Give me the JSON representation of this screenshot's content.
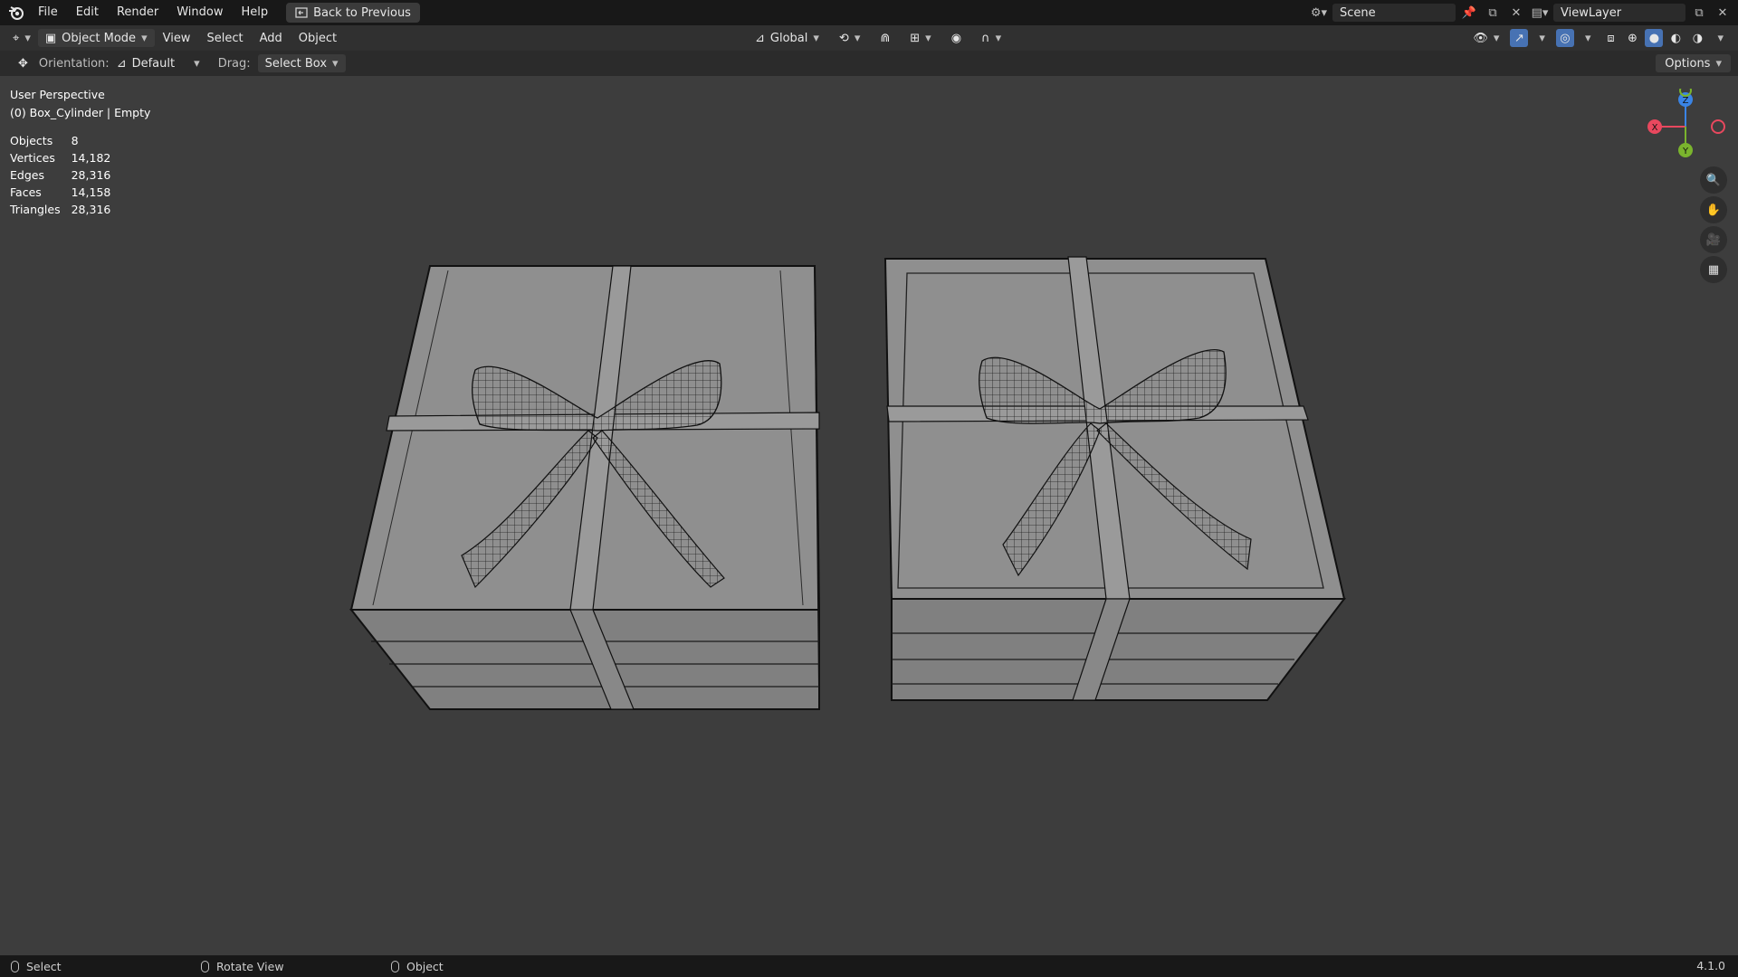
{
  "topbar": {
    "menus": [
      "File",
      "Edit",
      "Render",
      "Window",
      "Help"
    ],
    "back_button": "Back to Previous",
    "scene": "Scene",
    "view_layer": "ViewLayer"
  },
  "header": {
    "mode": "Object Mode",
    "menus": [
      "View",
      "Select",
      "Add",
      "Object"
    ],
    "transform_orientation": "Global"
  },
  "tool_settings": {
    "orientation_label": "Orientation:",
    "orientation_value": "Default",
    "drag_label": "Drag:",
    "drag_value": "Select Box",
    "options_label": "Options"
  },
  "viewport": {
    "view_name": "User Perspective",
    "active_object": "(0) Box_Cylinder | Empty",
    "stats": [
      {
        "label": "Objects",
        "value": "8"
      },
      {
        "label": "Vertices",
        "value": "14,182"
      },
      {
        "label": "Edges",
        "value": "28,316"
      },
      {
        "label": "Faces",
        "value": "14,158"
      },
      {
        "label": "Triangles",
        "value": "28,316"
      }
    ],
    "gizmo": {
      "x": "X",
      "y": "Y",
      "z": "Z"
    }
  },
  "statusbar": {
    "select": "Select",
    "rotate_view": "Rotate View",
    "object": "Object",
    "version": "4.1.0"
  },
  "colors": {
    "viewport_bg": "#3d3d3d",
    "mesh_fill": "#8e8e8e",
    "axis_x": "#e8485e",
    "axis_y": "#7ab42d",
    "axis_z": "#3a84e5",
    "active_button": "#4772b3"
  }
}
